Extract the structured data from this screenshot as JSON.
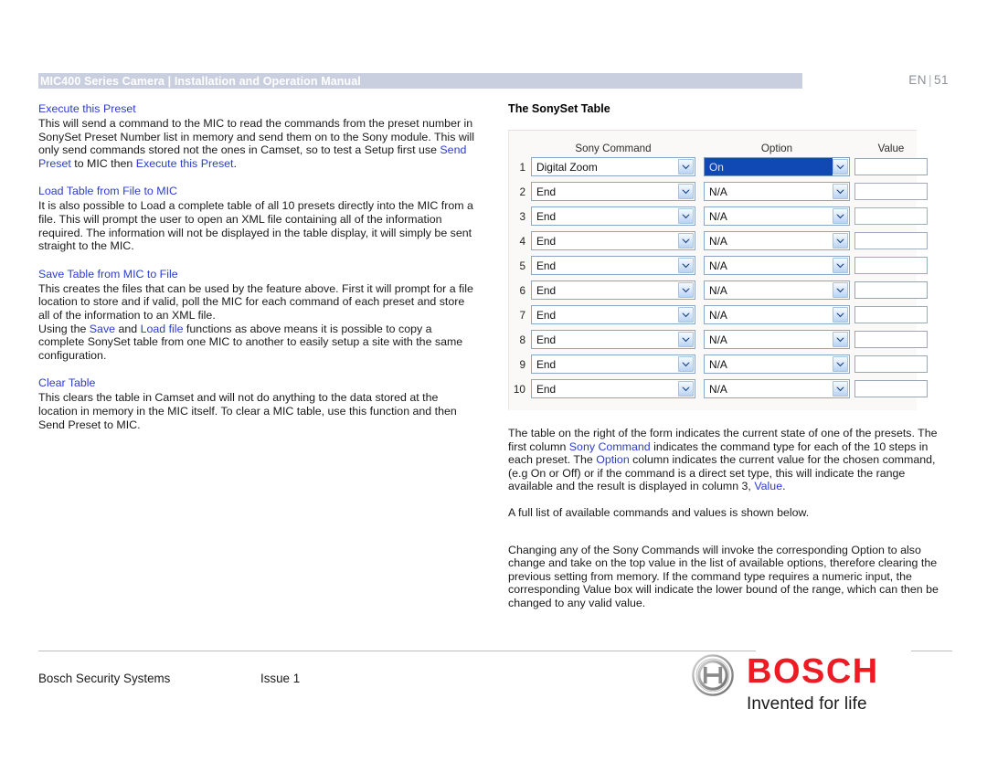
{
  "header": {
    "title": "MIC400 Series Camera | Installation and Operation Manual",
    "language": "EN",
    "separator": "|",
    "page_number": "51",
    "bar_color": "#c9cfdf",
    "link_color": "#2b3cd0"
  },
  "left_column": {
    "sections": [
      {
        "heading": "Execute this Preset",
        "paragraphs": [
          {
            "runs": [
              {
                "text": "This will send a command to the MIC to read the commands from the preset number in SonySet Preset Number list in memory and send them on to the Sony module. This will only send commands stored not the ones in Camset, so to test a Setup first use ",
                "link": false
              },
              {
                "text": "Send Preset",
                "link": true
              },
              {
                "text": " to MIC then ",
                "link": false
              },
              {
                "text": "Execute this Preset",
                "link": true
              },
              {
                "text": ".",
                "link": false
              }
            ]
          }
        ]
      },
      {
        "heading": "Load Table from File to MIC",
        "paragraphs": [
          {
            "runs": [
              {
                "text": "It is also possible to Load a complete table of all 10 presets directly into the MIC from a file. This will prompt the user to open an XML file containing all of the information required. The information will not be displayed in the table display, it will simply be sent straight to the MIC.",
                "link": false
              }
            ]
          }
        ]
      },
      {
        "heading": "Save Table from MIC to File",
        "paragraphs": [
          {
            "runs": [
              {
                "text": "This creates the files that can be used by the feature above. First it will prompt for a file location to store and if valid, poll the MIC for each command of each preset and store all of the information to an XML file.",
                "link": false
              }
            ]
          },
          {
            "runs": [
              {
                "text": "Using the ",
                "link": false
              },
              {
                "text": "Save",
                "link": true
              },
              {
                "text": " and ",
                "link": false
              },
              {
                "text": "Load file",
                "link": true
              },
              {
                "text": " functions as above means it is possible to copy a complete SonySet table from one MIC to another to easily setup a site with the same configuration.",
                "link": false
              }
            ]
          }
        ]
      },
      {
        "heading": "Clear Table",
        "paragraphs": [
          {
            "runs": [
              {
                "text": "This clears the table in Camset and will not do anything to the data stored at the location in memory in the MIC itself. To clear a MIC table, use this function and then Send Preset to MIC.",
                "link": false
              }
            ]
          }
        ]
      }
    ]
  },
  "right_column": {
    "title": "The SonySet Table",
    "table": {
      "columns": [
        "Sony Command",
        "Option",
        "Value"
      ],
      "rows": [
        {
          "num": "1",
          "command": "Digital Zoom",
          "option": "On",
          "value": "",
          "option_selected": true
        },
        {
          "num": "2",
          "command": "End",
          "option": "N/A",
          "value": "",
          "option_selected": false
        },
        {
          "num": "3",
          "command": "End",
          "option": "N/A",
          "value": "",
          "option_selected": false
        },
        {
          "num": "4",
          "command": "End",
          "option": "N/A",
          "value": "",
          "option_selected": false
        },
        {
          "num": "5",
          "command": "End",
          "option": "N/A",
          "value": "",
          "option_selected": false
        },
        {
          "num": "6",
          "command": "End",
          "option": "N/A",
          "value": "",
          "option_selected": false
        },
        {
          "num": "7",
          "command": "End",
          "option": "N/A",
          "value": "",
          "option_selected": false
        },
        {
          "num": "8",
          "command": "End",
          "option": "N/A",
          "value": "",
          "option_selected": false
        },
        {
          "num": "9",
          "command": "End",
          "option": "N/A",
          "value": "",
          "option_selected": false
        },
        {
          "num": "10",
          "command": "End",
          "option": "N/A",
          "value": "",
          "option_selected": false
        }
      ],
      "selected_highlight_color": "#1048b4"
    },
    "paragraphs": [
      {
        "runs": [
          {
            "text": "The table on the right of the form indicates the current state of one of the presets. The first column ",
            "link": false
          },
          {
            "text": "Sony Command",
            "link": true
          },
          {
            "text": " indicates the command type for each of the 10 steps in each preset. The ",
            "link": false
          },
          {
            "text": "Option",
            "link": true
          },
          {
            "text": " column indicates the current value for the chosen command, (e.g On or Off) or if the command is a direct set type, this will indicate the range available and the result is displayed in column 3, ",
            "link": false
          },
          {
            "text": "Value",
            "link": true
          },
          {
            "text": ".",
            "link": false
          }
        ]
      },
      {
        "runs": [
          {
            "text": " A full list of available commands and values is shown below.",
            "link": false
          }
        ]
      },
      {
        "runs": [
          {
            "text": "Changing any of the Sony Commands will invoke the corresponding Option to also change and take on the top value in the list of available options, therefore clearing the previous setting from memory. If the command type requires a numeric input, the corresponding Value box will indicate the lower bound of the range, which can then be changed to any valid value.",
            "link": false
          }
        ]
      }
    ]
  },
  "footer": {
    "company": "Bosch Security Systems",
    "issue": "Issue 1",
    "brand": "BOSCH",
    "tagline": "Invented for life",
    "brand_color": "#ed1c24"
  }
}
